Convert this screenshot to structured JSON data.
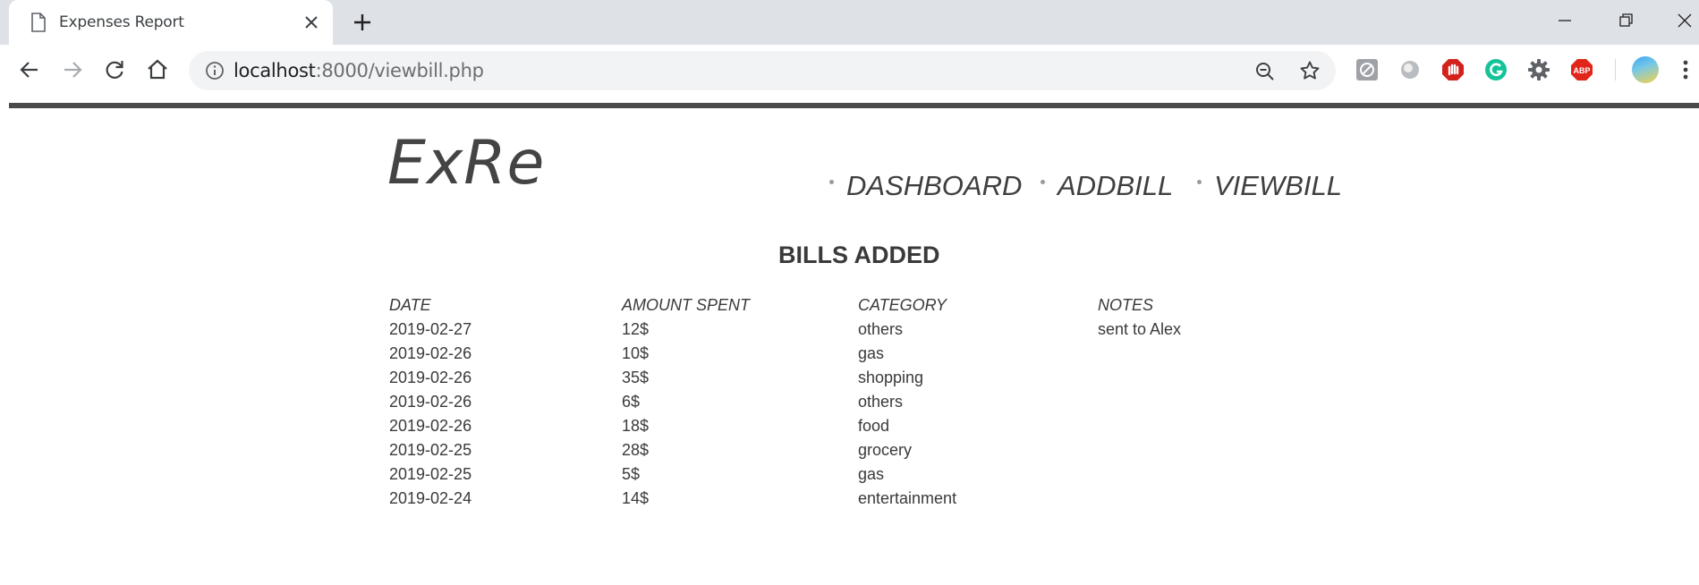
{
  "browser": {
    "tab_title": "Expenses Report",
    "url_host": "localhost",
    "url_rest": ":8000/viewbill.php"
  },
  "site": {
    "logo": "ExRe",
    "nav": [
      {
        "label": "DASHBOARD"
      },
      {
        "label": "ADDBILL"
      },
      {
        "label": "VIEWBILL"
      }
    ]
  },
  "bills": {
    "heading": "BILLS ADDED",
    "columns": [
      "DATE",
      "AMOUNT SPENT",
      "CATEGORY",
      "NOTES"
    ],
    "rows": [
      {
        "date": "2019-02-27",
        "amount": "12$",
        "category": "others",
        "notes": "sent to Alex"
      },
      {
        "date": "2019-02-26",
        "amount": "10$",
        "category": "gas",
        "notes": ""
      },
      {
        "date": "2019-02-26",
        "amount": "35$",
        "category": "shopping",
        "notes": ""
      },
      {
        "date": "2019-02-26",
        "amount": "6$",
        "category": "others",
        "notes": ""
      },
      {
        "date": "2019-02-26",
        "amount": "18$",
        "category": "food",
        "notes": ""
      },
      {
        "date": "2019-02-25",
        "amount": "28$",
        "category": "grocery",
        "notes": ""
      },
      {
        "date": "2019-02-25",
        "amount": "5$",
        "category": "gas",
        "notes": ""
      },
      {
        "date": "2019-02-24",
        "amount": "14$",
        "category": "entertainment",
        "notes": ""
      }
    ]
  }
}
